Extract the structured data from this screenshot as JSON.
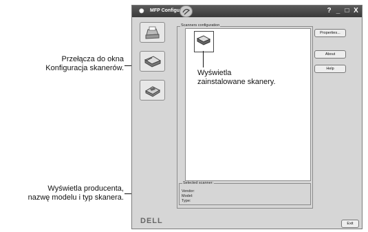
{
  "window": {
    "title": "MFP Configurator",
    "controls": [
      "?",
      "_",
      "□",
      "X"
    ]
  },
  "sidebar": {
    "items": [
      {
        "name": "printer",
        "icon": "printer-icon"
      },
      {
        "name": "scanner",
        "icon": "scanner-icon"
      },
      {
        "name": "port",
        "icon": "port-icon"
      }
    ]
  },
  "scanners": {
    "group_label": "Scanners configuration",
    "selected_group_label": "Selected scanner:",
    "vendor_label": "Vendor:",
    "model_label": "Model:",
    "type_label": "Type:"
  },
  "buttons": {
    "properties": "Properties...",
    "about": "About",
    "help": "Help",
    "exit": "Exit"
  },
  "brand": {
    "logo_text": "DELL"
  },
  "annotations": {
    "switch_line1": "Przełącza do okna",
    "switch_line2": "Konfiguracja skanerów.",
    "installed_line1": "Wyświetla",
    "installed_line2": "zainstalowane skanery.",
    "vendor_line1": "Wyświetla producenta,",
    "vendor_line2": "nazwę modelu i typ skanera."
  }
}
